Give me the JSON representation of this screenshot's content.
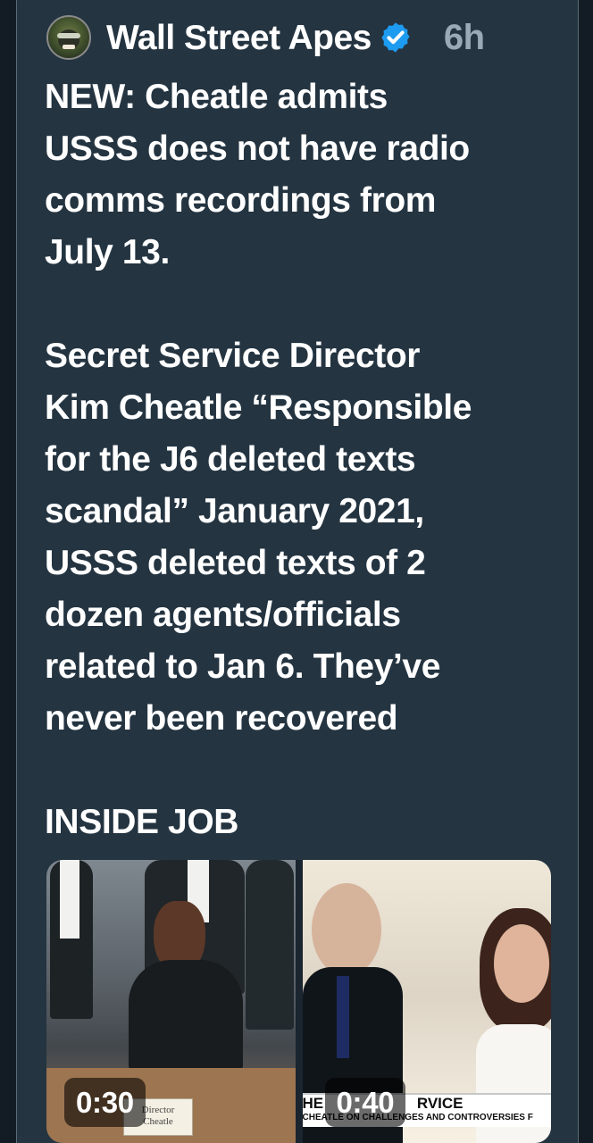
{
  "post": {
    "author": "Wall Street Apes",
    "time": "6h",
    "text_lines": [
      "NEW: Cheatle admits",
      "USSS does not have radio",
      "comms recordings from",
      "July 13.",
      "Secret Service Director",
      "Kim Cheatle “Responsible",
      "for the J6 deleted texts",
      "scandal” January 2021,",
      "USSS deleted texts of 2",
      "dozen agents/officials",
      "related to Jan 6. They’ve",
      "never been recovered",
      "INSIDE JOB"
    ]
  },
  "media": [
    {
      "duration": "0:30",
      "name_plate": [
        "Director",
        "Cheatle"
      ]
    },
    {
      "duration": "0:40",
      "banner": "HE",
      "banner_right": "RVICE",
      "banner_sub": "CHEATLE ON CHALLENGES AND CONTROVERSIES F"
    }
  ],
  "colors": {
    "background": "#243441",
    "text": "#ffffff",
    "muted": "#9aa9b6",
    "verified": "#1d9bf0"
  },
  "icons": {
    "avatar": "ape-avatar-icon",
    "verified": "verified-badge-icon"
  }
}
